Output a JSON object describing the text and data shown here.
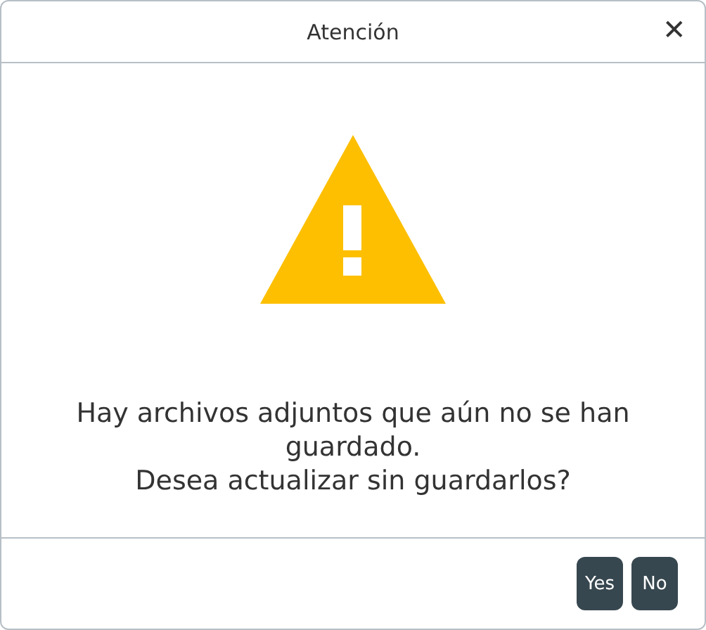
{
  "dialog": {
    "title": "Atención",
    "close": "✕"
  },
  "message": [
    "Hay archivos adjuntos que aún no se han guardado.",
    "Desea actualizar sin guardarlos?"
  ],
  "buttons": [
    {
      "label": "Yes"
    },
    {
      "label": "No"
    }
  ]
}
